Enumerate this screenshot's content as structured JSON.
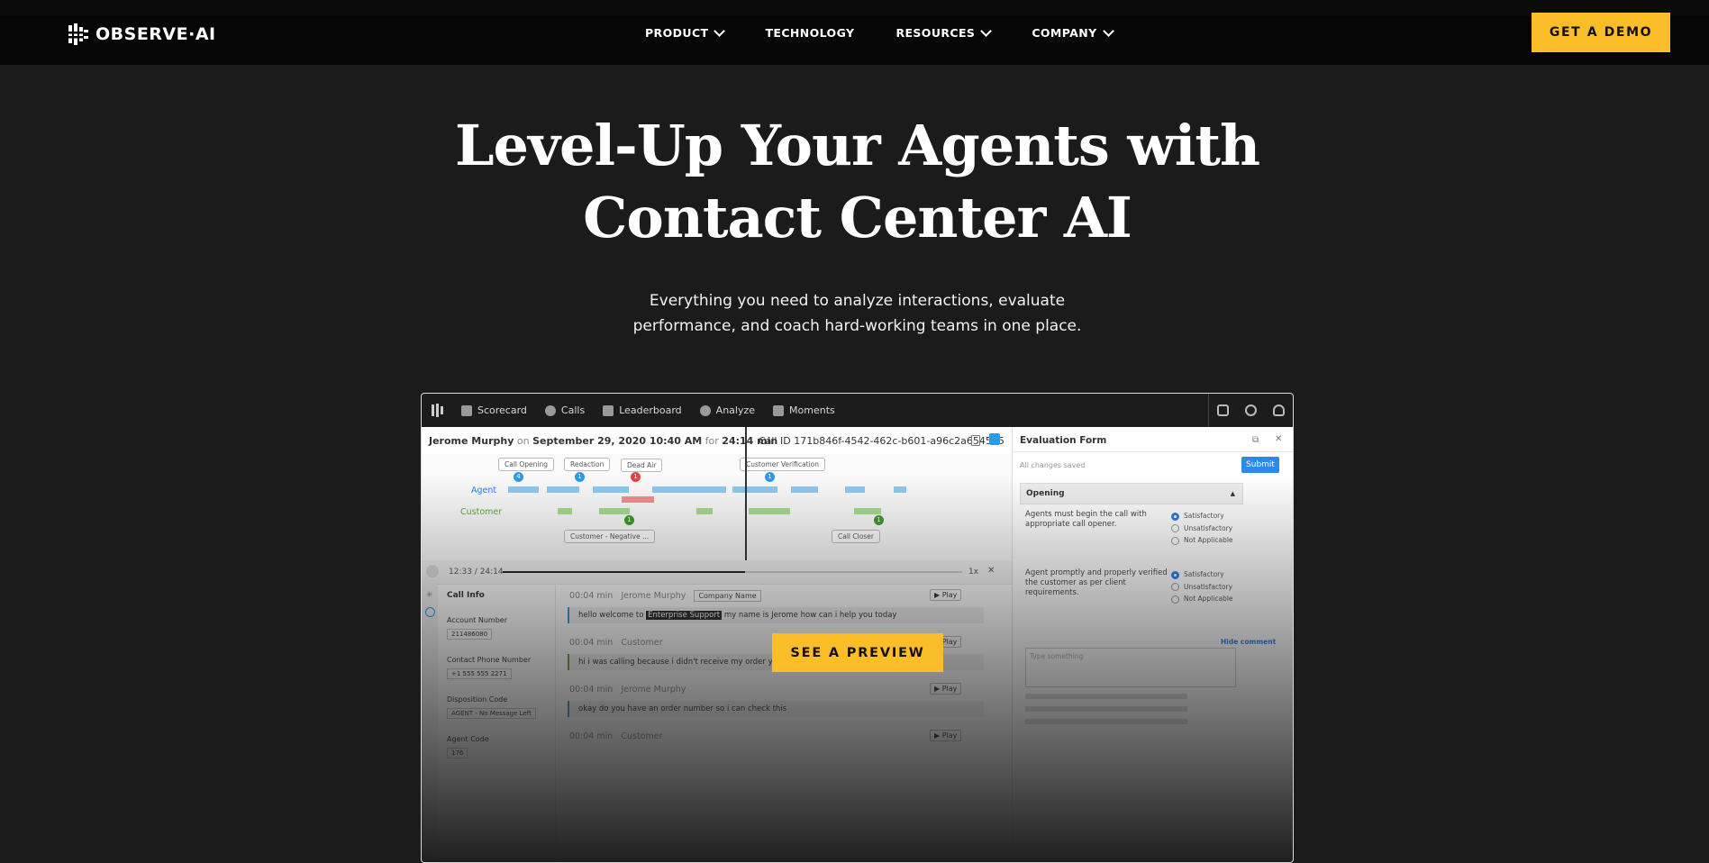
{
  "nav": {
    "logo": "OBSERVE·AI",
    "items": [
      {
        "label": "PRODUCT",
        "dropdown": true
      },
      {
        "label": "TECHNOLOGY",
        "dropdown": false
      },
      {
        "label": "RESOURCES",
        "dropdown": true
      },
      {
        "label": "COMPANY",
        "dropdown": true
      }
    ],
    "cta": "GET A DEMO"
  },
  "hero": {
    "title_line1": "Level-Up Your Agents with",
    "title_line2": "Contact Center AI",
    "subtitle_line1": "Everything you need to analyze interactions, evaluate",
    "subtitle_line2": "performance, and coach hard-working teams in one place."
  },
  "preview": {
    "button": "SEE A PREVIEW",
    "app_nav": [
      "Scorecard",
      "Calls",
      "Leaderboard",
      "Analyze",
      "Moments"
    ],
    "call_agent": "Jerome Murphy",
    "call_on": "on",
    "call_date": "September 29, 2020 10:40 AM",
    "call_for": "for",
    "call_duration": "24:14 min",
    "call_id": "Call ID 171b846f-4542-462c-b601-a96c2a6545d5",
    "tags": [
      "Call Opening",
      "Redaction",
      "Dead Air",
      "Customer Verification",
      "Customer - Negative ...",
      "Call Closer"
    ],
    "track_agent": "Agent",
    "track_customer": "Customer",
    "time": "12:33 / 24:14",
    "speed": "1x",
    "call_info_title": "Call Info",
    "call_info": [
      {
        "label": "Account Number",
        "value": "211486080"
      },
      {
        "label": "Contact Phone Number",
        "value": "+1 555 555 2271"
      },
      {
        "label": "Disposition Code",
        "value": "AGENT - No Message Left"
      },
      {
        "label": "Agent Code",
        "value": "176"
      }
    ],
    "messages": [
      {
        "time": "00:04 min",
        "speaker": "Jerome Murphy",
        "badge": "Company Name",
        "text_pre": "hello welcome to",
        "highlight": "Enterprise Support",
        "text_post": "my name is Jerome how can i help you today"
      },
      {
        "time": "00:04 min",
        "speaker": "Customer",
        "text": "hi i was calling because i didn't receive my order yet"
      },
      {
        "time": "00:04 min",
        "speaker": "Jerome Murphy",
        "text": "okay do you have an order number so i can check this"
      },
      {
        "time": "00:04 min",
        "speaker": "Customer",
        "text": ""
      }
    ],
    "play_label": "Play",
    "eval": {
      "title": "Evaluation Form",
      "saved": "All changes saved",
      "submit": "Submit",
      "section": "Opening",
      "q1": "Agents must begin the call with appropriate call opener.",
      "q2": "Agent promptly and properly verified the customer as per client requirements.",
      "options": [
        "Satisfactory",
        "Unsatisfactory",
        "Not Applicable"
      ],
      "hide_comment": "Hide comment",
      "comment_placeholder": "Type something"
    }
  }
}
